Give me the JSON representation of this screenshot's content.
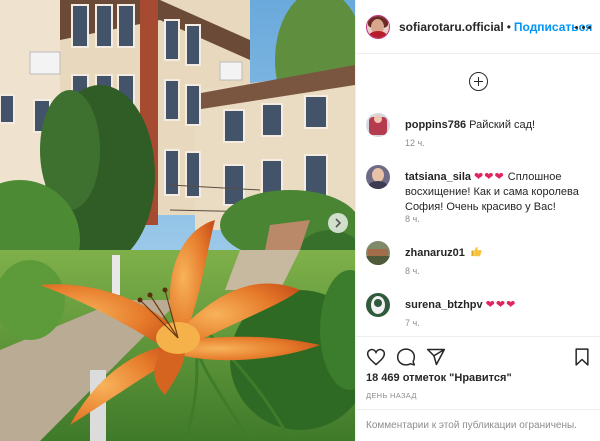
{
  "post_header": {
    "username": "sofiarotaru.official",
    "separator": "•",
    "follow_label": "Подписаться"
  },
  "comments": [
    {
      "username": "poppins786",
      "text": "Райский сад!",
      "time": "12 ч."
    },
    {
      "username": "tatsiana_sila",
      "emoji": "❤❤❤",
      "text": " Сплошное восхищение! Как и сама королева София! Очень красиво у Вас!",
      "time": "8 ч."
    },
    {
      "username": "zhanaruz01",
      "emoji_icon": "thumbs-up-icon",
      "time": "8 ч."
    },
    {
      "username": "surena_btzhpv",
      "emoji": "❤❤❤",
      "time": "7 ч."
    }
  ],
  "actions": {
    "like_icon": "heart-outline-icon",
    "comment_icon": "comment-bubble-icon",
    "share_icon": "paper-plane-icon",
    "save_icon": "bookmark-icon"
  },
  "likes_text": "18 469 отметок \"Нравится\"",
  "post_time": "ДЕНЬ НАЗАД",
  "comments_disabled_text": "Комментарии к этой публикации ограничены.",
  "colors": {
    "link_blue": "#0095f6",
    "heart_red": "#e0245e",
    "secondary_text": "#8e8e8e",
    "primary_text": "#262626",
    "border": "#efefef"
  }
}
